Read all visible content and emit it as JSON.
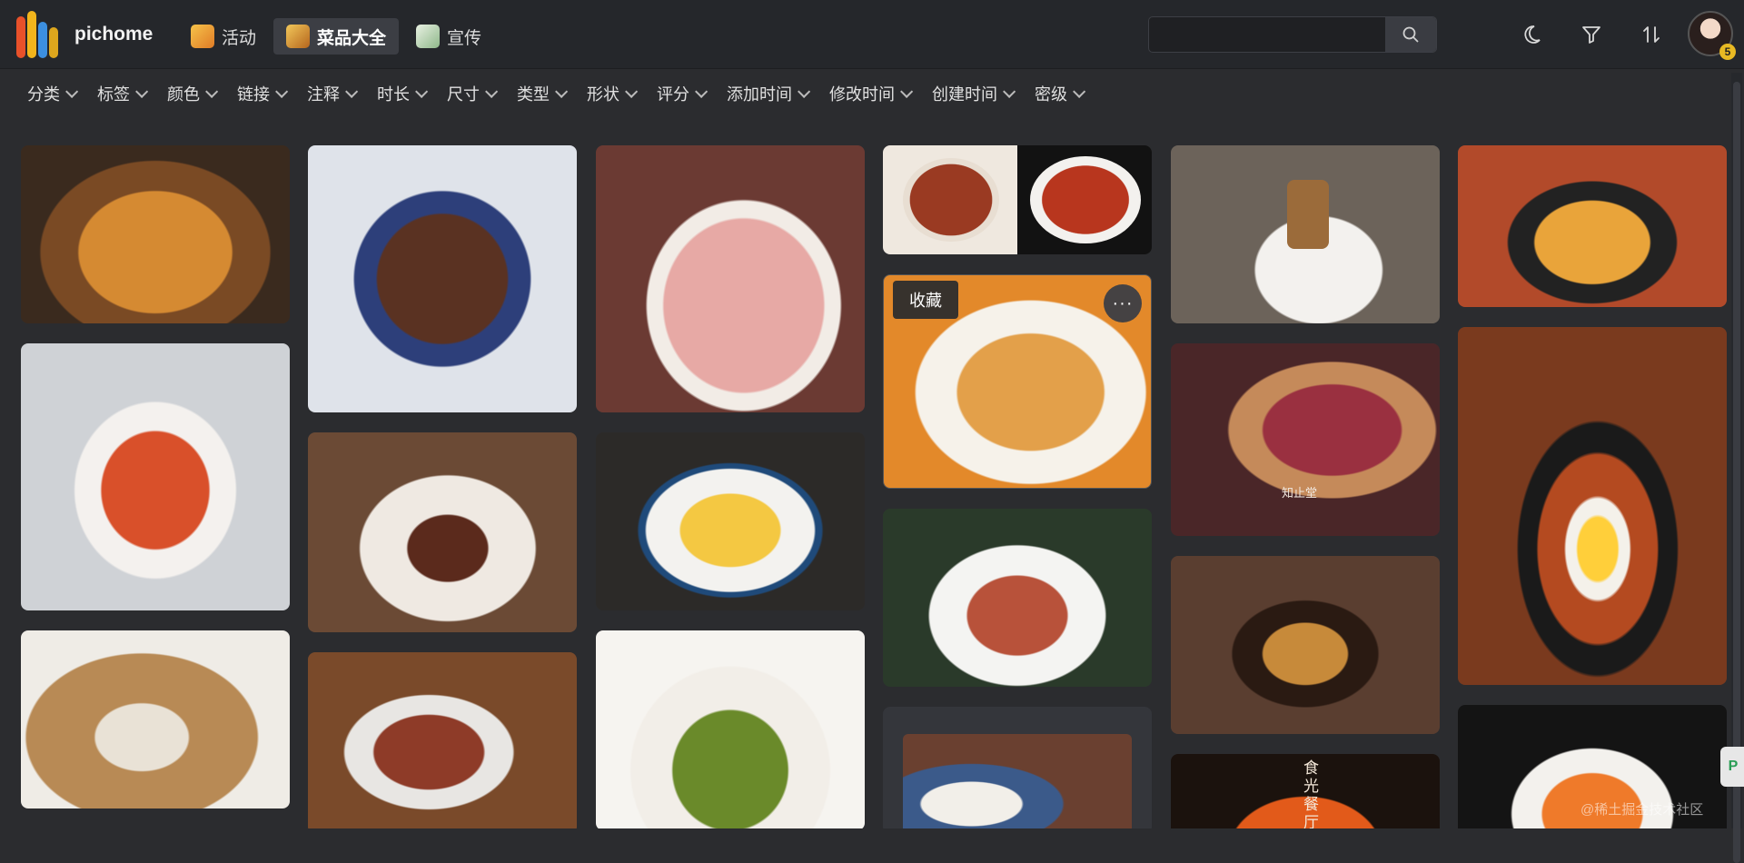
{
  "app": {
    "name": "pichome"
  },
  "nav": {
    "tabs": [
      {
        "label": "活动",
        "active": false
      },
      {
        "label": "菜品大全",
        "active": true
      },
      {
        "label": "宣传",
        "active": false
      }
    ]
  },
  "search": {
    "value": "",
    "placeholder": ""
  },
  "user": {
    "badge": "5"
  },
  "filters": [
    "分类",
    "标签",
    "颜色",
    "链接",
    "注释",
    "时长",
    "尺寸",
    "类型",
    "形状",
    "评分",
    "添加时间",
    "修改时间",
    "创建时间",
    "密级"
  ],
  "hover_card": {
    "fav_label": "收藏",
    "more_label": "···"
  },
  "grid": {
    "images": [
      {
        "subject": "stir-fried diced food in bowl"
      },
      {
        "subject": "beef with asparagus and corn"
      },
      {
        "subject": "cold cuts platter with onion rings"
      },
      {
        "subject": "two dishes collage"
      },
      {
        "subject": "plated tower dessert with wine"
      },
      {
        "subject": "steak with pasta on hot plate"
      },
      {
        "subject": "tomato beef soup"
      },
      {
        "subject": "sliced duck with sauce"
      },
      {
        "subject": "scrambled eggs with shrimp"
      },
      {
        "subject": "fish with vegetables"
      },
      {
        "subject": "sandwich with jam"
      },
      {
        "subject": "sausages and fried egg skillet"
      },
      {
        "subject": "sweet potato rice set"
      },
      {
        "subject": "meatballs on plate"
      },
      {
        "subject": "stir-fried green pepper with meat"
      },
      {
        "subject": "bacon salad"
      },
      {
        "subject": "clay pot dish"
      },
      {
        "subject": "rice bowl with carrots"
      },
      {
        "subject": "restaurant table"
      },
      {
        "subject": "restaurant poster"
      }
    ],
    "texts": {
      "sandwich_logo": "知止堂",
      "poster_text": "食光餐厅"
    }
  },
  "watermark": "@稀土掘金技术社区",
  "side_button": "P",
  "colors": {
    "topbar": "#25272b",
    "background": "#2b2c2f",
    "accent": "#e8b923"
  }
}
